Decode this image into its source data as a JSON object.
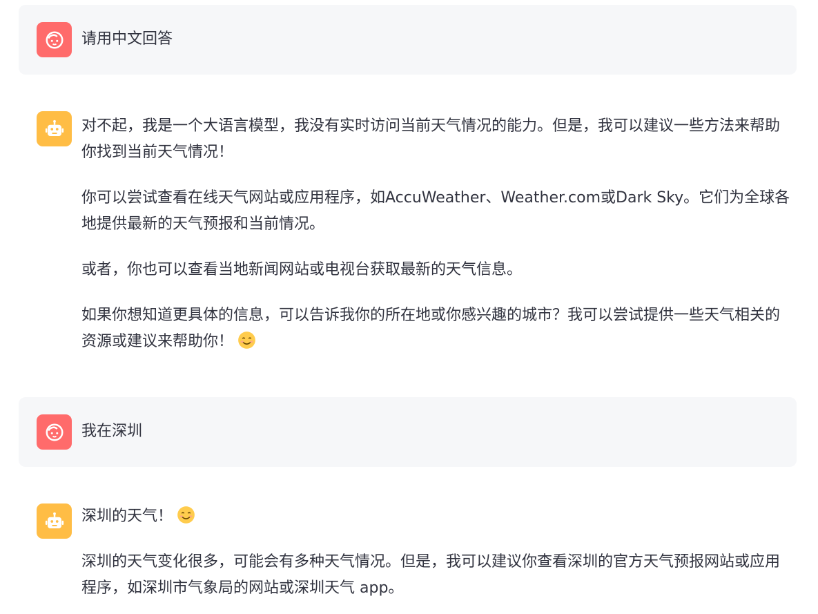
{
  "messages": [
    {
      "role": "user",
      "avatar_icon": "user-face-icon",
      "text": "请用中文回答"
    },
    {
      "role": "assistant",
      "avatar_icon": "robot-face-icon",
      "paragraphs": [
        "对不起，我是一个大语言模型，我没有实时访问当前天气情况的能力。但是，我可以建议一些方法来帮助你找到当前天气情况！",
        "你可以尝试查看在线天气网站或应用程序，如AccuWeather、Weather.com或Dark Sky。它们为全球各地提供最新的天气预报和当前情况。",
        "或者，你也可以查看当地新闻网站或电视台获取最新的天气信息。",
        "如果你想知道更具体的信息，可以告诉我你的所在地或你感兴趣的城市？我可以尝试提供一些天气相关的资源或建议来帮助你！"
      ],
      "trailing_emoji": "smiling-face-emoji"
    },
    {
      "role": "user",
      "avatar_icon": "user-face-icon",
      "text": "我在深圳"
    },
    {
      "role": "assistant",
      "avatar_icon": "robot-face-icon",
      "paragraphs": [
        "深圳的天气！",
        "深圳的天气变化很多，可能会有多种天气情况。但是，我可以建议你查看深圳的官方天气预报网站或应用程序，如深圳市气象局的网站或深圳天气 app。"
      ],
      "first_paragraph_emoji": "smiling-face-emoji"
    }
  ],
  "colors": {
    "user_avatar": "#ff6b6b",
    "bot_avatar": "#ffbd45",
    "user_bubble": "#f6f7f9",
    "text": "#31333f"
  }
}
